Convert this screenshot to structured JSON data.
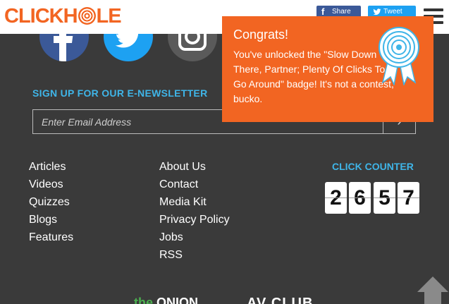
{
  "header": {
    "logo_text_left": "CLICKH",
    "logo_text_right": "LE",
    "share_facebook": "Share",
    "share_twitter": "Tweet"
  },
  "social": {
    "facebook_glyph": "f",
    "twitter_glyph": "t",
    "instagram_glyph": "ig"
  },
  "newsletter": {
    "title": "SIGN UP FOR OUR E-NEWSLETTER",
    "placeholder": "Enter Email Address"
  },
  "links": {
    "col1": [
      "Articles",
      "Videos",
      "Quizzes",
      "Blogs",
      "Features"
    ],
    "col2": [
      "About Us",
      "Contact",
      "Media Kit",
      "Privacy Policy",
      "Jobs",
      "RSS"
    ]
  },
  "counter": {
    "title": "CLICK COUNTER",
    "digits": [
      "2",
      "6",
      "5",
      "7"
    ]
  },
  "footer": {
    "onion_prefix": "the",
    "onion": "ONION",
    "avclub": "AV CLUB"
  },
  "popup": {
    "title": "Congrats!",
    "message": "You've unlocked the \"Slow Down There, Partner; Plenty Of Clicks To Go Around\" badge! It's not a contest, bucko."
  },
  "colors": {
    "brand_orange": "#f26522",
    "accent_blue": "#3fb5e8",
    "background": "#3a3a3a"
  }
}
